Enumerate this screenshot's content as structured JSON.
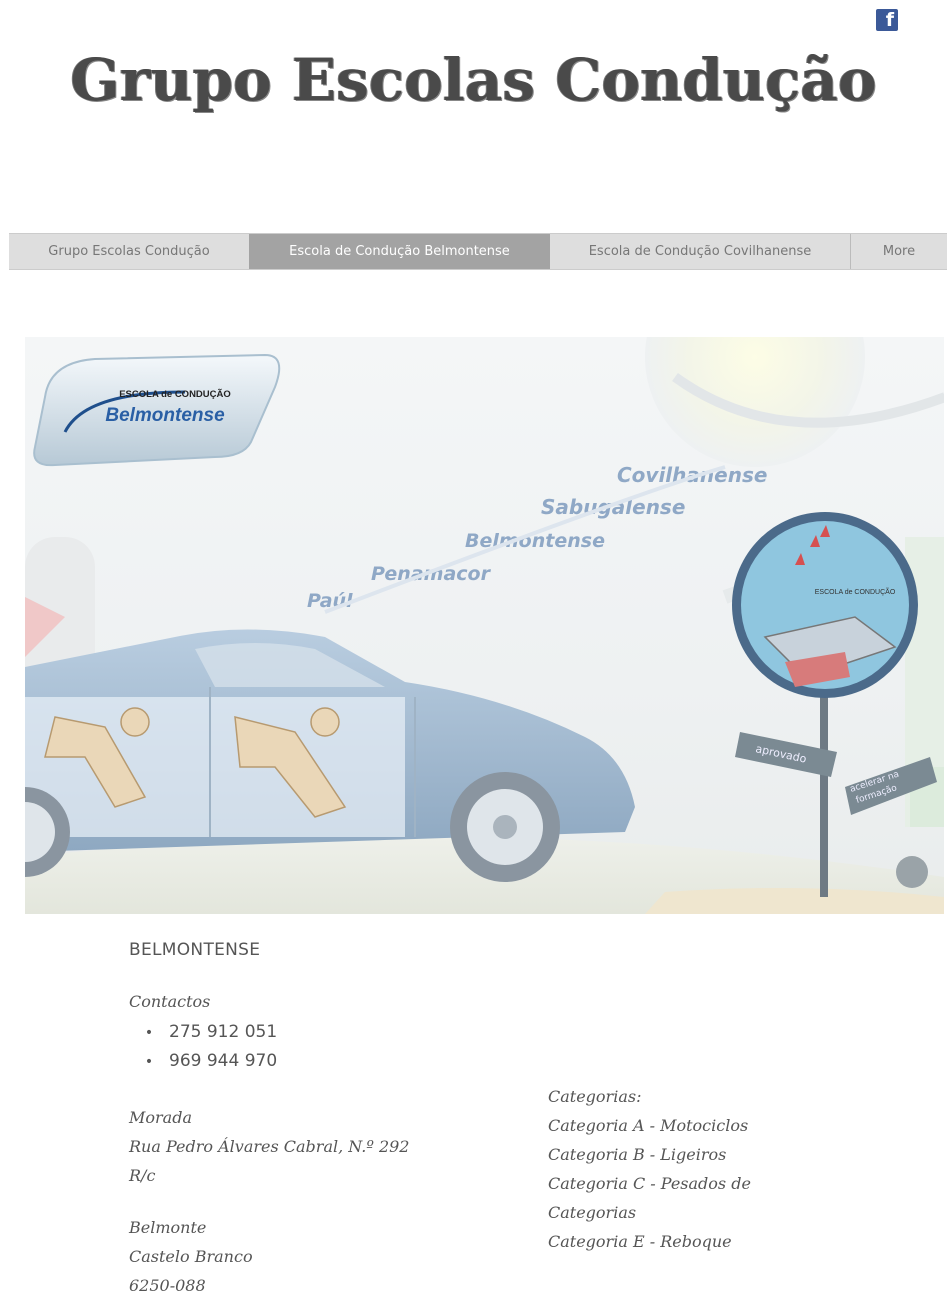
{
  "header": {
    "title": "Grupo Escolas Condução",
    "facebook_icon": "facebook-icon"
  },
  "nav": {
    "items": [
      {
        "label": "Grupo Escolas Condução"
      },
      {
        "label": "Escola de Condução Belmontense",
        "active": true
      },
      {
        "label": "Escola de Condução Covilhanense"
      },
      {
        "label": "More"
      }
    ]
  },
  "hero": {
    "logo_top": "ESCOLA de CONDUÇÃO",
    "logo_main": "Belmontense",
    "towns": [
      "Covilhanense",
      "Sabugalense",
      "Belmontense",
      "Penamacor",
      "Paúl"
    ],
    "sign_text": "ESCOLA de CONDUÇÃO",
    "arrow_left": "aprovado",
    "arrow_right_1": "acelerar na",
    "arrow_right_2": "formação"
  },
  "info": {
    "title": "BELMONTENSE",
    "contactos_label": "Contactos",
    "phones": [
      "275 912 051",
      "969 944 970"
    ],
    "morada_label": "Morada",
    "morada_line1": "Rua Pedro Álvares Cabral, N.º 292",
    "morada_line2": "R/c",
    "city": "Belmonte",
    "district": "Castelo Branco",
    "postal": "6250-088",
    "categorias_label": "Categorias:",
    "categorias": [
      "Categoria A - Motociclos",
      "Categoria B - Ligeiros",
      "Categoria C - Pesados de",
      "Categorias",
      "Categoria E - Reboque"
    ]
  },
  "colors": {
    "nav_bg": "#dedede",
    "nav_active": "#a3a3a3",
    "facebook": "#3b5998",
    "town_text": "#8fa8c6",
    "car_blue": "#9db6cf"
  }
}
